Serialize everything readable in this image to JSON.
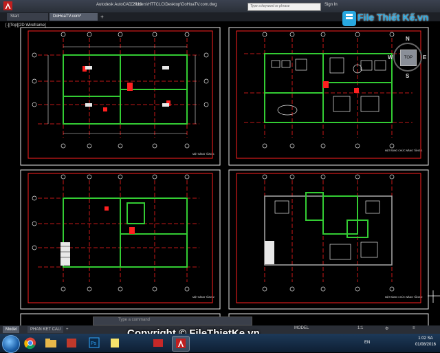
{
  "window": {
    "app_title": "Autodesk AutoCAD 2016",
    "file_path": "C:\\Users\\HTTCLC\\Desktop\\DoHoaTV.com.dwg",
    "search_placeholder": "Type a keyword or phrase",
    "sign_in": "Sign In"
  },
  "tabs": [
    {
      "label": "Start"
    },
    {
      "label": "DoHoaTV.com*"
    }
  ],
  "tab_add": "+",
  "viewport": {
    "label": "[-][Top][2D Wireframe]"
  },
  "viewcube": {
    "north": "N",
    "south": "S",
    "west": "W",
    "east": "E",
    "face": "TOP"
  },
  "sheets": [
    {
      "caption": "MẶT BẰNG TẦNG 1"
    },
    {
      "caption": "MẶT BẰNG CHỨC NĂNG TẦNG 1"
    },
    {
      "caption": "MẶT BẰNG TẦNG 2"
    },
    {
      "caption": "MẶT BẰNG CHỨC NĂNG TẦNG 2"
    }
  ],
  "command_line": {
    "placeholder": "Type a command"
  },
  "layout_tabs": [
    {
      "label": "Model"
    },
    {
      "label": "PHAN KET CAU"
    }
  ],
  "layout_add": "+",
  "status": {
    "model": "MODEL",
    "scale": "1:1"
  },
  "taskbar": {
    "language": "EN",
    "time": "1:02 SA",
    "date": "01/08/2016"
  },
  "watermark": "Copyright © FileThietKe.vn",
  "logo_text": "File Thiết Kế.vn",
  "colors": {
    "titlebar": "#2a2f38",
    "model_space": "#000000",
    "walls_green": "#33cc33",
    "lines_red": "#ff2020",
    "dims_white": "#e8e8e8",
    "brand_blue": "#28a8e0"
  }
}
